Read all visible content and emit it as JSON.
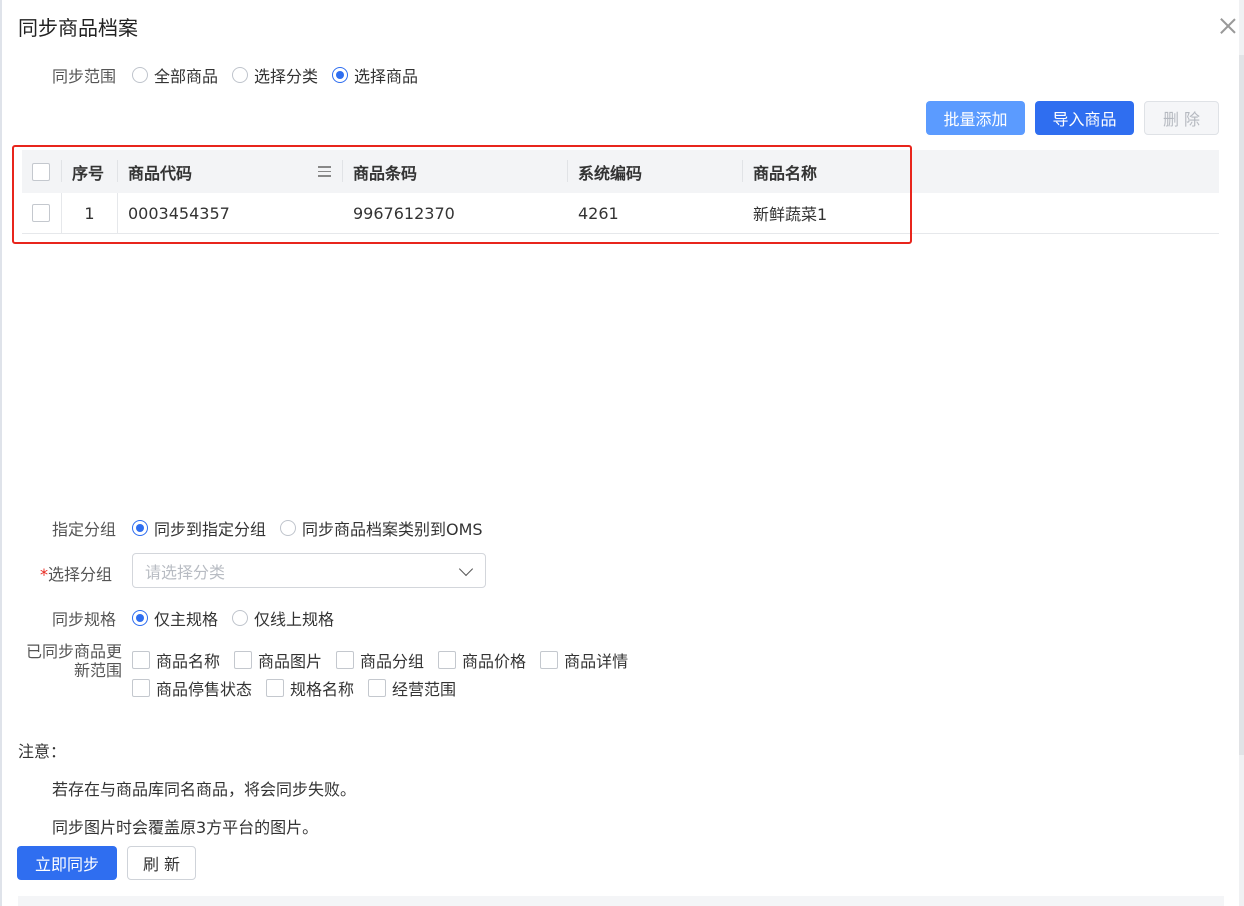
{
  "dialog": {
    "title": "同步商品档案"
  },
  "sync_range": {
    "label": "同步范围",
    "options": [
      "全部商品",
      "选择分类",
      "选择商品"
    ],
    "selected": "选择商品"
  },
  "toolbar": {
    "batch_add": "批量添加",
    "import": "导入商品",
    "delete": "删 除"
  },
  "table": {
    "columns": [
      "序号",
      "商品代码",
      "商品条码",
      "系统编码",
      "商品名称"
    ],
    "rows": [
      {
        "index": "1",
        "code": "0003454357",
        "barcode": "9967612370",
        "system_code": "4261",
        "name": "新鲜蔬菜1"
      }
    ]
  },
  "group": {
    "label": "指定分组",
    "options": [
      "同步到指定分组",
      "同步商品档案类别到OMS"
    ],
    "selected": "同步到指定分组"
  },
  "select_group": {
    "required_mark": "*",
    "label": "选择分组",
    "placeholder": "请选择分类"
  },
  "spec": {
    "label": "同步规格",
    "options": [
      "仅主规格",
      "仅线上规格"
    ],
    "selected": "仅主规格"
  },
  "update_range": {
    "label_line1": "已同步商品更",
    "label_line2": "新范围",
    "options_row1": [
      "商品名称",
      "商品图片",
      "商品分组",
      "商品价格",
      "商品详情"
    ],
    "options_row2": [
      "商品停售状态",
      "规格名称",
      "经营范围"
    ]
  },
  "notes": {
    "title": "注意：",
    "items": [
      "若存在与商品库同名商品，将会同步失败。",
      "同步图片时会覆盖原3方平台的图片。"
    ]
  },
  "actions": {
    "sync_now": "立即同步",
    "refresh": "刷 新"
  },
  "colors": {
    "primary": "#2f6ef0",
    "primary_light": "#5b9bff",
    "highlight": "#e8251c"
  }
}
